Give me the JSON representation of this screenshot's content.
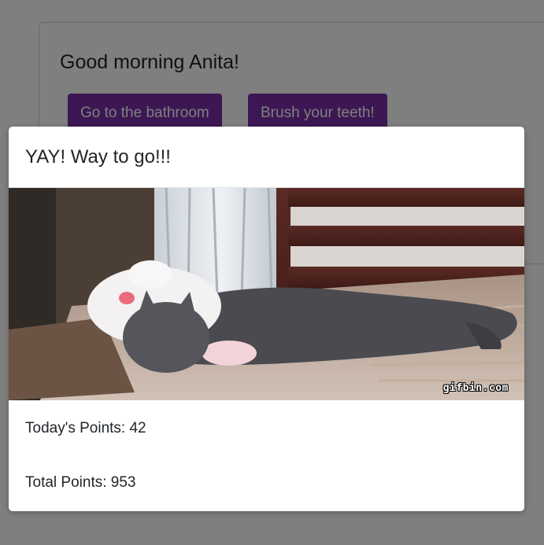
{
  "card": {
    "greeting": "Good morning Anita!",
    "tasks": [
      {
        "label": "Go to the bathroom"
      },
      {
        "label": "Brush your teeth!"
      }
    ]
  },
  "modal": {
    "title": "YAY! Way to go!!!",
    "image": {
      "watermark": "gifbin.com"
    },
    "today_points": "Today's Points: 42",
    "total_points": "Total Points: 953"
  },
  "colors": {
    "button": "#7b2ea8",
    "backdrop": "rgba(0,0,0,0.5)"
  }
}
